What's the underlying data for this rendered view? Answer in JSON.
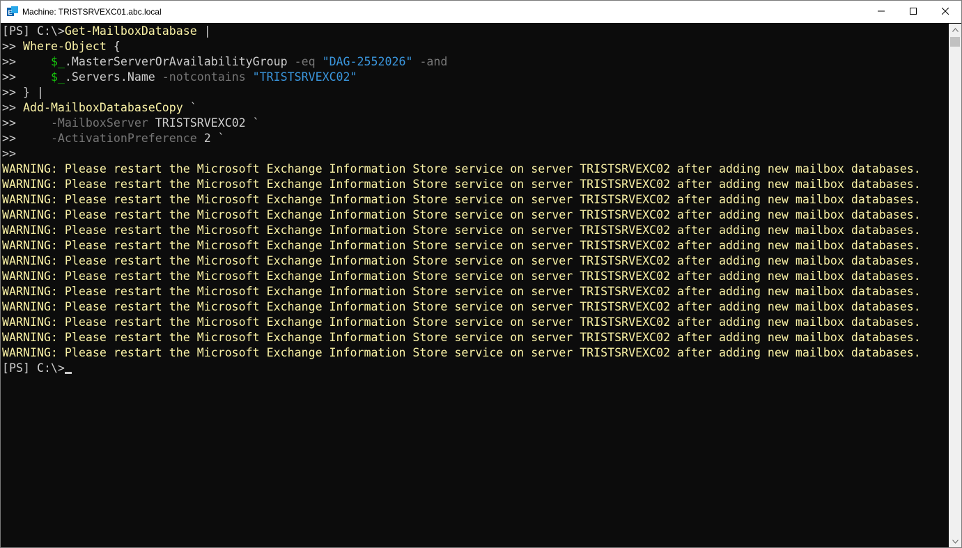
{
  "window": {
    "title": "Machine: TRISTSRVEXC01.abc.local",
    "icon": "exchange-management-shell-icon"
  },
  "controls": {
    "minimize": "minimize-icon",
    "maximize": "maximize-icon",
    "close": "close-icon"
  },
  "colors": {
    "background": "#0c0c0c",
    "default_text": "#cccccc",
    "command": "#f9f1a5",
    "parameter": "#767676",
    "string": "#3a96dd",
    "variable": "#16c60c",
    "warning": "#f9f1a5"
  },
  "console": {
    "lines": [
      [
        {
          "t": "[PS] C:\\>",
          "c": "plain"
        },
        {
          "t": "Get-MailboxDatabase",
          "c": "cmd"
        },
        {
          "t": " |",
          "c": "plain"
        }
      ],
      [
        {
          "t": ">> ",
          "c": "plain"
        },
        {
          "t": "Where-Object",
          "c": "cmd"
        },
        {
          "t": " {",
          "c": "plain"
        }
      ],
      [
        {
          "t": ">>     ",
          "c": "plain"
        },
        {
          "t": "$_",
          "c": "var"
        },
        {
          "t": ".MasterServerOrAvailabilityGroup ",
          "c": "plain"
        },
        {
          "t": "-eq ",
          "c": "param"
        },
        {
          "t": "\"DAG-2552026\"",
          "c": "str"
        },
        {
          "t": " -and",
          "c": "param"
        }
      ],
      [
        {
          "t": ">>     ",
          "c": "plain"
        },
        {
          "t": "$_",
          "c": "var"
        },
        {
          "t": ".Servers.Name ",
          "c": "plain"
        },
        {
          "t": "-notcontains ",
          "c": "param"
        },
        {
          "t": "\"TRISTSRVEXC02\"",
          "c": "str"
        }
      ],
      [
        {
          "t": ">> } |",
          "c": "plain"
        }
      ],
      [
        {
          "t": ">> ",
          "c": "plain"
        },
        {
          "t": "Add-MailboxDatabaseCopy",
          "c": "cmd"
        },
        {
          "t": " `",
          "c": "plain"
        }
      ],
      [
        {
          "t": ">>     ",
          "c": "plain"
        },
        {
          "t": "-MailboxServer ",
          "c": "param"
        },
        {
          "t": "TRISTSRVEXC02 `",
          "c": "plain"
        }
      ],
      [
        {
          "t": ">>     ",
          "c": "plain"
        },
        {
          "t": "-ActivationPreference ",
          "c": "param"
        },
        {
          "t": "2 `",
          "c": "plain"
        }
      ],
      [
        {
          "t": ">>",
          "c": "plain"
        }
      ],
      [
        {
          "t": "WARNING: Please restart the Microsoft Exchange Information Store service on server TRISTSRVEXC02 after adding new mailbox databases.",
          "c": "warn"
        }
      ],
      [
        {
          "t": "WARNING: Please restart the Microsoft Exchange Information Store service on server TRISTSRVEXC02 after adding new mailbox databases.",
          "c": "warn"
        }
      ],
      [
        {
          "t": "WARNING: Please restart the Microsoft Exchange Information Store service on server TRISTSRVEXC02 after adding new mailbox databases.",
          "c": "warn"
        }
      ],
      [
        {
          "t": "WARNING: Please restart the Microsoft Exchange Information Store service on server TRISTSRVEXC02 after adding new mailbox databases.",
          "c": "warn"
        }
      ],
      [
        {
          "t": "WARNING: Please restart the Microsoft Exchange Information Store service on server TRISTSRVEXC02 after adding new mailbox databases.",
          "c": "warn"
        }
      ],
      [
        {
          "t": "WARNING: Please restart the Microsoft Exchange Information Store service on server TRISTSRVEXC02 after adding new mailbox databases.",
          "c": "warn"
        }
      ],
      [
        {
          "t": "WARNING: Please restart the Microsoft Exchange Information Store service on server TRISTSRVEXC02 after adding new mailbox databases.",
          "c": "warn"
        }
      ],
      [
        {
          "t": "WARNING: Please restart the Microsoft Exchange Information Store service on server TRISTSRVEXC02 after adding new mailbox databases.",
          "c": "warn"
        }
      ],
      [
        {
          "t": "WARNING: Please restart the Microsoft Exchange Information Store service on server TRISTSRVEXC02 after adding new mailbox databases.",
          "c": "warn"
        }
      ],
      [
        {
          "t": "WARNING: Please restart the Microsoft Exchange Information Store service on server TRISTSRVEXC02 after adding new mailbox databases.",
          "c": "warn"
        }
      ],
      [
        {
          "t": "WARNING: Please restart the Microsoft Exchange Information Store service on server TRISTSRVEXC02 after adding new mailbox databases.",
          "c": "warn"
        }
      ],
      [
        {
          "t": "WARNING: Please restart the Microsoft Exchange Information Store service on server TRISTSRVEXC02 after adding new mailbox databases.",
          "c": "warn"
        }
      ],
      [
        {
          "t": "WARNING: Please restart the Microsoft Exchange Information Store service on server TRISTSRVEXC02 after adding new mailbox databases.",
          "c": "warn"
        }
      ]
    ],
    "prompt": "[PS] C:\\>"
  }
}
